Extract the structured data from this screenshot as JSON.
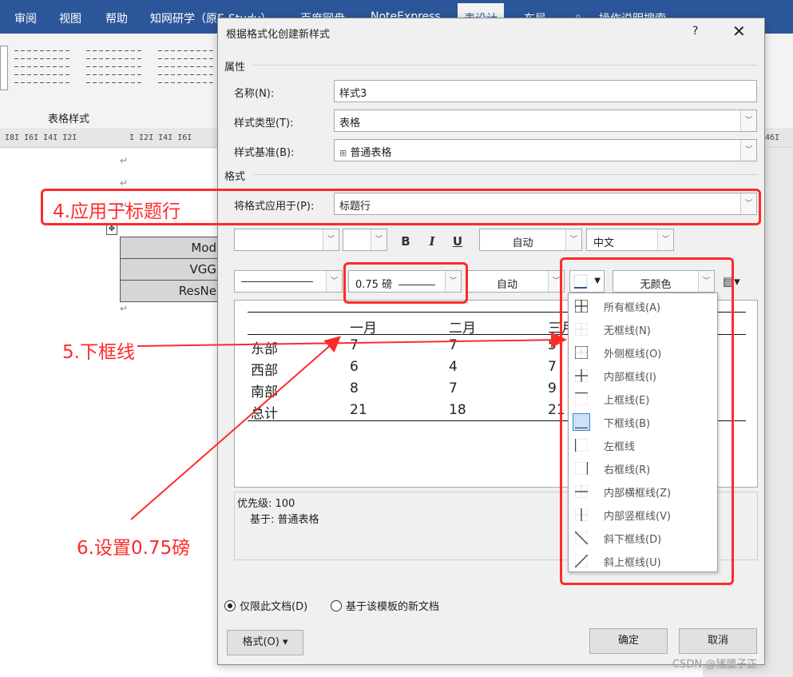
{
  "ribbon": {
    "tabs": [
      "审阅",
      "视图",
      "帮助",
      "知网研学（原E-Study）",
      "百度网盘",
      "NoteExpress",
      "表设计",
      "布局"
    ],
    "search": "操作说明搜索",
    "gallery_label": "表格样式"
  },
  "ruler": {
    "left": "I8I  I6I  I4I  I2I",
    "right": "I  I2I  I4I  I6I",
    "far_right": "46I"
  },
  "document": {
    "para_mark": "↵",
    "table_rows": [
      "Mod",
      "VGG",
      "ResNe"
    ]
  },
  "dialog": {
    "title": "根据格式化创建新样式",
    "help": "?",
    "close": "✕",
    "properties_section": "属性",
    "name_label": "名称(N):",
    "name_value": "样式3",
    "type_label": "样式类型(T):",
    "type_value": "表格",
    "base_label": "样式基准(B):",
    "base_value": "普通表格",
    "format_section": "格式",
    "apply_label": "将格式应用于(P):",
    "apply_value": "标题行",
    "font_name": "",
    "font_size": "",
    "bold": "B",
    "italic": "I",
    "underline": "U",
    "font_color": "自动",
    "script": "中文",
    "line_width": "0.75 磅",
    "line_color": "自动",
    "fill_color": "无颜色",
    "preview": {
      "header": [
        "一月",
        "二月",
        "三月"
      ],
      "rows": [
        {
          "name": "东部",
          "v": [
            "7",
            "7",
            "5"
          ]
        },
        {
          "name": "西部",
          "v": [
            "6",
            "4",
            "7"
          ]
        },
        {
          "name": "南部",
          "v": [
            "8",
            "7",
            "9"
          ]
        },
        {
          "name": "总计",
          "v": [
            "21",
            "18",
            "21"
          ]
        }
      ]
    },
    "desc_line1": "优先级: 100",
    "desc_line2": "基于: 普通表格",
    "radio_doc": "仅限此文档(D)",
    "radio_template": "基于该模板的新文档",
    "format_btn": "格式(O) ▾",
    "ok_btn": "确定",
    "cancel_btn": "取消"
  },
  "border_menu": [
    {
      "label": "所有框线(A)",
      "icon": "all-borders-icon"
    },
    {
      "label": "无框线(N)",
      "icon": "no-border-icon"
    },
    {
      "label": "外侧框线(O)",
      "icon": "outside-borders-icon"
    },
    {
      "label": "内部框线(I)",
      "icon": "inside-borders-icon"
    },
    {
      "label": "上框线(E)",
      "icon": "top-border-icon"
    },
    {
      "label": "下框线(B)",
      "icon": "bottom-border-icon",
      "selected": true
    },
    {
      "label": "左框线",
      "icon": "left-border-icon"
    },
    {
      "label": "右框线(R)",
      "icon": "right-border-icon"
    },
    {
      "label": "内部横框线(Z)",
      "icon": "inside-horizontal-border-icon"
    },
    {
      "label": "内部竖框线(V)",
      "icon": "inside-vertical-border-icon"
    },
    {
      "label": "斜下框线(D)",
      "icon": "diagonal-down-border-icon"
    },
    {
      "label": "斜上框线(U)",
      "icon": "diagonal-up-border-icon"
    }
  ],
  "annotations": {
    "step4": "4.应用于标题行",
    "step5": "5.下框线",
    "step6": "6.设置0.75磅",
    "color": "#ff2a2a"
  },
  "watermark": "CSDN @猪腰子正"
}
